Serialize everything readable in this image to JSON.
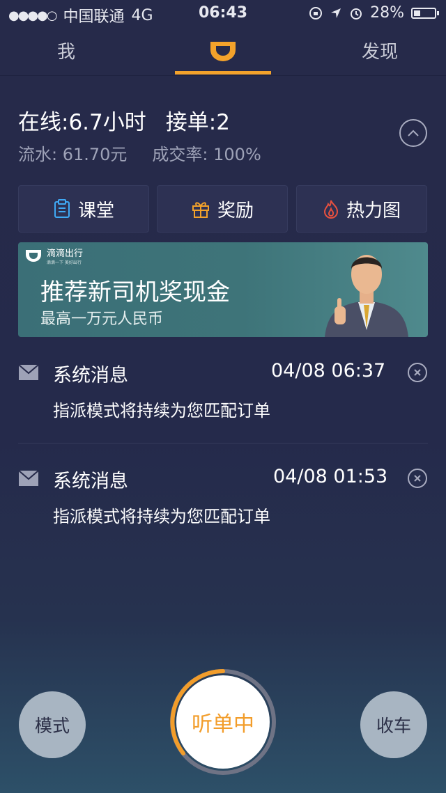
{
  "status_bar": {
    "signal_dots": "●●●●○",
    "carrier": "中国联通",
    "network": "4G",
    "time": "06:43",
    "battery": "28%"
  },
  "nav": {
    "tab_me": "我",
    "tab_discover": "发现",
    "accent_color": "#f3a22b"
  },
  "stats": {
    "online": "在线:6.7小时",
    "orders": "接单:2",
    "revenue": "流水: 61.70元",
    "completion_rate": "成交率: 100%"
  },
  "tools": [
    {
      "label": "课堂",
      "icon": "clipboard-icon"
    },
    {
      "label": "奖励",
      "icon": "gift-icon"
    },
    {
      "label": "热力图",
      "icon": "flame-icon"
    }
  ],
  "banner": {
    "brand": "滴滴出行",
    "slogan": "滴滴一下 美好出行",
    "headline": "推荐新司机奖现金",
    "subline": "最高一万元人民币"
  },
  "messages": [
    {
      "title": "系统消息",
      "time": "04/08 06:37",
      "body": "指派模式将持续为您匹配订单"
    },
    {
      "title": "系统消息",
      "time": "04/08 01:53",
      "body": "指派模式将持续为您匹配订单"
    }
  ],
  "bottom": {
    "mode_label": "模式",
    "listening_label": "听单中",
    "stop_label": "收车"
  }
}
